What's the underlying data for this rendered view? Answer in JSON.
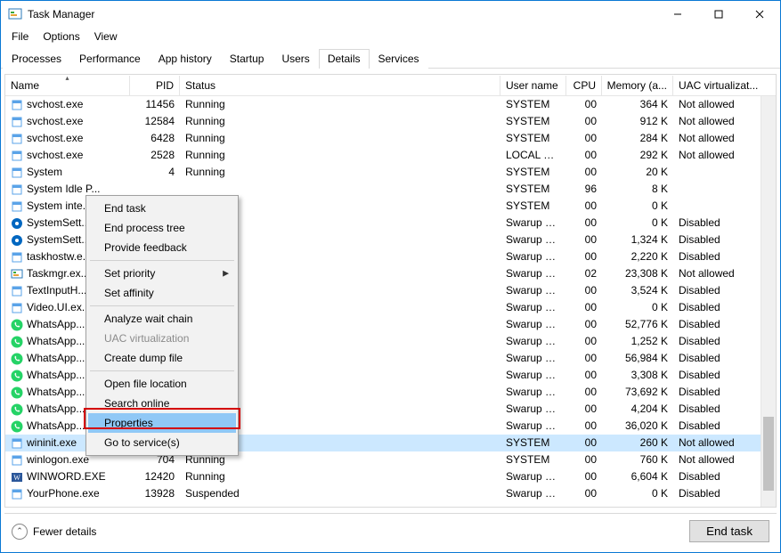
{
  "window": {
    "title": "Task Manager",
    "btn_min": "—",
    "btn_max": "☐",
    "btn_close": "✕"
  },
  "menubar": [
    "File",
    "Options",
    "View"
  ],
  "tabs": [
    "Processes",
    "Performance",
    "App history",
    "Startup",
    "Users",
    "Details",
    "Services"
  ],
  "active_tab": 5,
  "columns": [
    "Name",
    "PID",
    "Status",
    "User name",
    "CPU",
    "Memory (a...",
    "UAC virtualizat..."
  ],
  "sort_col": 0,
  "rows": [
    {
      "icon": "exe",
      "name": "svchost.exe",
      "pid": "11456",
      "status": "Running",
      "user": "SYSTEM",
      "cpu": "00",
      "mem": "364 K",
      "uac": "Not allowed",
      "sel": false
    },
    {
      "icon": "exe",
      "name": "svchost.exe",
      "pid": "12584",
      "status": "Running",
      "user": "SYSTEM",
      "cpu": "00",
      "mem": "912 K",
      "uac": "Not allowed",
      "sel": false
    },
    {
      "icon": "exe",
      "name": "svchost.exe",
      "pid": "6428",
      "status": "Running",
      "user": "SYSTEM",
      "cpu": "00",
      "mem": "284 K",
      "uac": "Not allowed",
      "sel": false
    },
    {
      "icon": "exe",
      "name": "svchost.exe",
      "pid": "2528",
      "status": "Running",
      "user": "LOCAL SE...",
      "cpu": "00",
      "mem": "292 K",
      "uac": "Not allowed",
      "sel": false
    },
    {
      "icon": "exe",
      "name": "System",
      "pid": "4",
      "status": "Running",
      "user": "SYSTEM",
      "cpu": "00",
      "mem": "20 K",
      "uac": "",
      "sel": false
    },
    {
      "icon": "exe",
      "name": "System Idle P...",
      "pid": "",
      "status": "",
      "user": "SYSTEM",
      "cpu": "96",
      "mem": "8 K",
      "uac": "",
      "sel": false
    },
    {
      "icon": "exe",
      "name": "System inte...",
      "pid": "",
      "status": "",
      "user": "SYSTEM",
      "cpu": "00",
      "mem": "0 K",
      "uac": "",
      "sel": false
    },
    {
      "icon": "gear",
      "name": "SystemSett...",
      "pid": "",
      "status": "",
      "user": "Swarup M...",
      "cpu": "00",
      "mem": "0 K",
      "uac": "Disabled",
      "sel": false
    },
    {
      "icon": "gear",
      "name": "SystemSett...",
      "pid": "",
      "status": "",
      "user": "Swarup M...",
      "cpu": "00",
      "mem": "1,324 K",
      "uac": "Disabled",
      "sel": false
    },
    {
      "icon": "exe",
      "name": "taskhostw.e...",
      "pid": "",
      "status": "",
      "user": "Swarup M...",
      "cpu": "00",
      "mem": "2,220 K",
      "uac": "Disabled",
      "sel": false
    },
    {
      "icon": "tm",
      "name": "Taskmgr.ex...",
      "pid": "",
      "status": "",
      "user": "Swarup M...",
      "cpu": "02",
      "mem": "23,308 K",
      "uac": "Not allowed",
      "sel": false
    },
    {
      "icon": "exe",
      "name": "TextInputH...",
      "pid": "",
      "status": "",
      "user": "Swarup M...",
      "cpu": "00",
      "mem": "3,524 K",
      "uac": "Disabled",
      "sel": false
    },
    {
      "icon": "exe",
      "name": "Video.UI.ex...",
      "pid": "",
      "status": "",
      "user": "Swarup M...",
      "cpu": "00",
      "mem": "0 K",
      "uac": "Disabled",
      "sel": false
    },
    {
      "icon": "wa",
      "name": "WhatsApp....",
      "pid": "",
      "status": "",
      "user": "Swarup M...",
      "cpu": "00",
      "mem": "52,776 K",
      "uac": "Disabled",
      "sel": false
    },
    {
      "icon": "wa",
      "name": "WhatsApp....",
      "pid": "",
      "status": "",
      "user": "Swarup M...",
      "cpu": "00",
      "mem": "1,252 K",
      "uac": "Disabled",
      "sel": false
    },
    {
      "icon": "wa",
      "name": "WhatsApp....",
      "pid": "",
      "status": "",
      "user": "Swarup M...",
      "cpu": "00",
      "mem": "56,984 K",
      "uac": "Disabled",
      "sel": false
    },
    {
      "icon": "wa",
      "name": "WhatsApp....",
      "pid": "",
      "status": "",
      "user": "Swarup M...",
      "cpu": "00",
      "mem": "3,308 K",
      "uac": "Disabled",
      "sel": false
    },
    {
      "icon": "wa",
      "name": "WhatsApp....",
      "pid": "",
      "status": "",
      "user": "Swarup M...",
      "cpu": "00",
      "mem": "73,692 K",
      "uac": "Disabled",
      "sel": false
    },
    {
      "icon": "wa",
      "name": "WhatsApp....",
      "pid": "",
      "status": "",
      "user": "Swarup M...",
      "cpu": "00",
      "mem": "4,204 K",
      "uac": "Disabled",
      "sel": false
    },
    {
      "icon": "wa",
      "name": "WhatsApp....",
      "pid": "",
      "status": "",
      "user": "Swarup M...",
      "cpu": "00",
      "mem": "36,020 K",
      "uac": "Disabled",
      "sel": false
    },
    {
      "icon": "exe",
      "name": "wininit.exe",
      "pid": "",
      "status": "",
      "user": "SYSTEM",
      "cpu": "00",
      "mem": "260 K",
      "uac": "Not allowed",
      "sel": true
    },
    {
      "icon": "exe",
      "name": "winlogon.exe",
      "pid": "704",
      "status": "Running",
      "user": "SYSTEM",
      "cpu": "00",
      "mem": "760 K",
      "uac": "Not allowed",
      "sel": false
    },
    {
      "icon": "word",
      "name": "WINWORD.EXE",
      "pid": "12420",
      "status": "Running",
      "user": "Swarup M...",
      "cpu": "00",
      "mem": "6,604 K",
      "uac": "Disabled",
      "sel": false
    },
    {
      "icon": "exe",
      "name": "YourPhone.exe",
      "pid": "13928",
      "status": "Suspended",
      "user": "Swarup M...",
      "cpu": "00",
      "mem": "0 K",
      "uac": "Disabled",
      "sel": false
    }
  ],
  "context_menu": [
    {
      "label": "End task",
      "type": "item"
    },
    {
      "label": "End process tree",
      "type": "item"
    },
    {
      "label": "Provide feedback",
      "type": "item"
    },
    {
      "type": "sep"
    },
    {
      "label": "Set priority",
      "type": "submenu"
    },
    {
      "label": "Set affinity",
      "type": "item"
    },
    {
      "type": "sep"
    },
    {
      "label": "Analyze wait chain",
      "type": "item"
    },
    {
      "label": "UAC virtualization",
      "type": "item",
      "disabled": true
    },
    {
      "label": "Create dump file",
      "type": "item"
    },
    {
      "type": "sep"
    },
    {
      "label": "Open file location",
      "type": "item"
    },
    {
      "label": "Search online",
      "type": "item"
    },
    {
      "label": "Properties",
      "type": "item",
      "highlight": true
    },
    {
      "label": "Go to service(s)",
      "type": "item"
    }
  ],
  "bottom": {
    "fewer": "Fewer details",
    "endtask": "End task"
  }
}
